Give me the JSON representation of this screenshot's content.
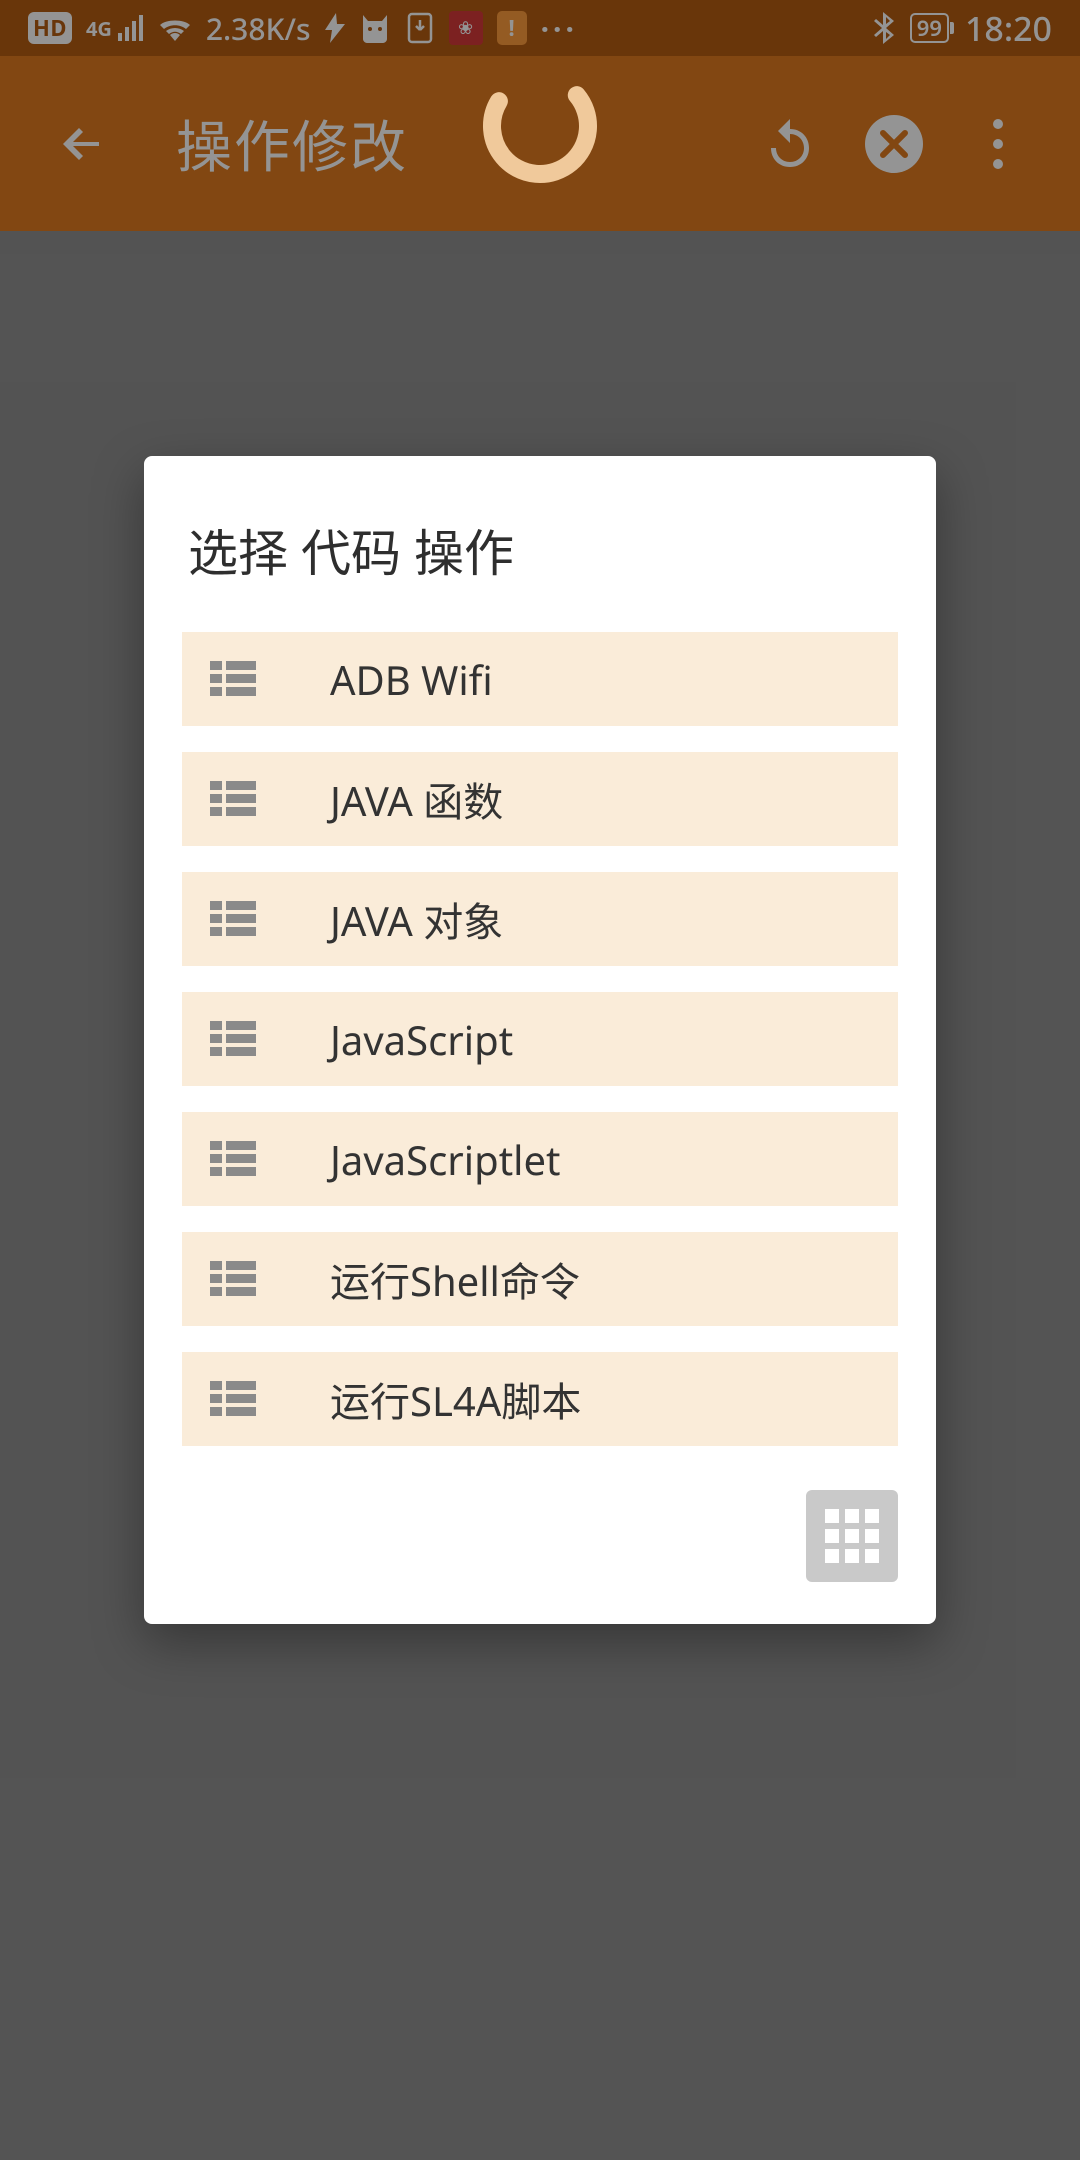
{
  "status": {
    "hd": "HD",
    "network_gen": "4G",
    "speed": "2.38K/s",
    "battery_pct": "99",
    "time": "18:20"
  },
  "appbar": {
    "title": "操作修改"
  },
  "dialog": {
    "title": "选择 代码 操作",
    "items": [
      {
        "label": "ADB Wifi"
      },
      {
        "label": "JAVA 函数"
      },
      {
        "label": "JAVA 对象"
      },
      {
        "label": "JavaScript"
      },
      {
        "label": "JavaScriptlet"
      },
      {
        "label": "运行Shell命令"
      },
      {
        "label": "运行SL4A脚本"
      }
    ]
  }
}
